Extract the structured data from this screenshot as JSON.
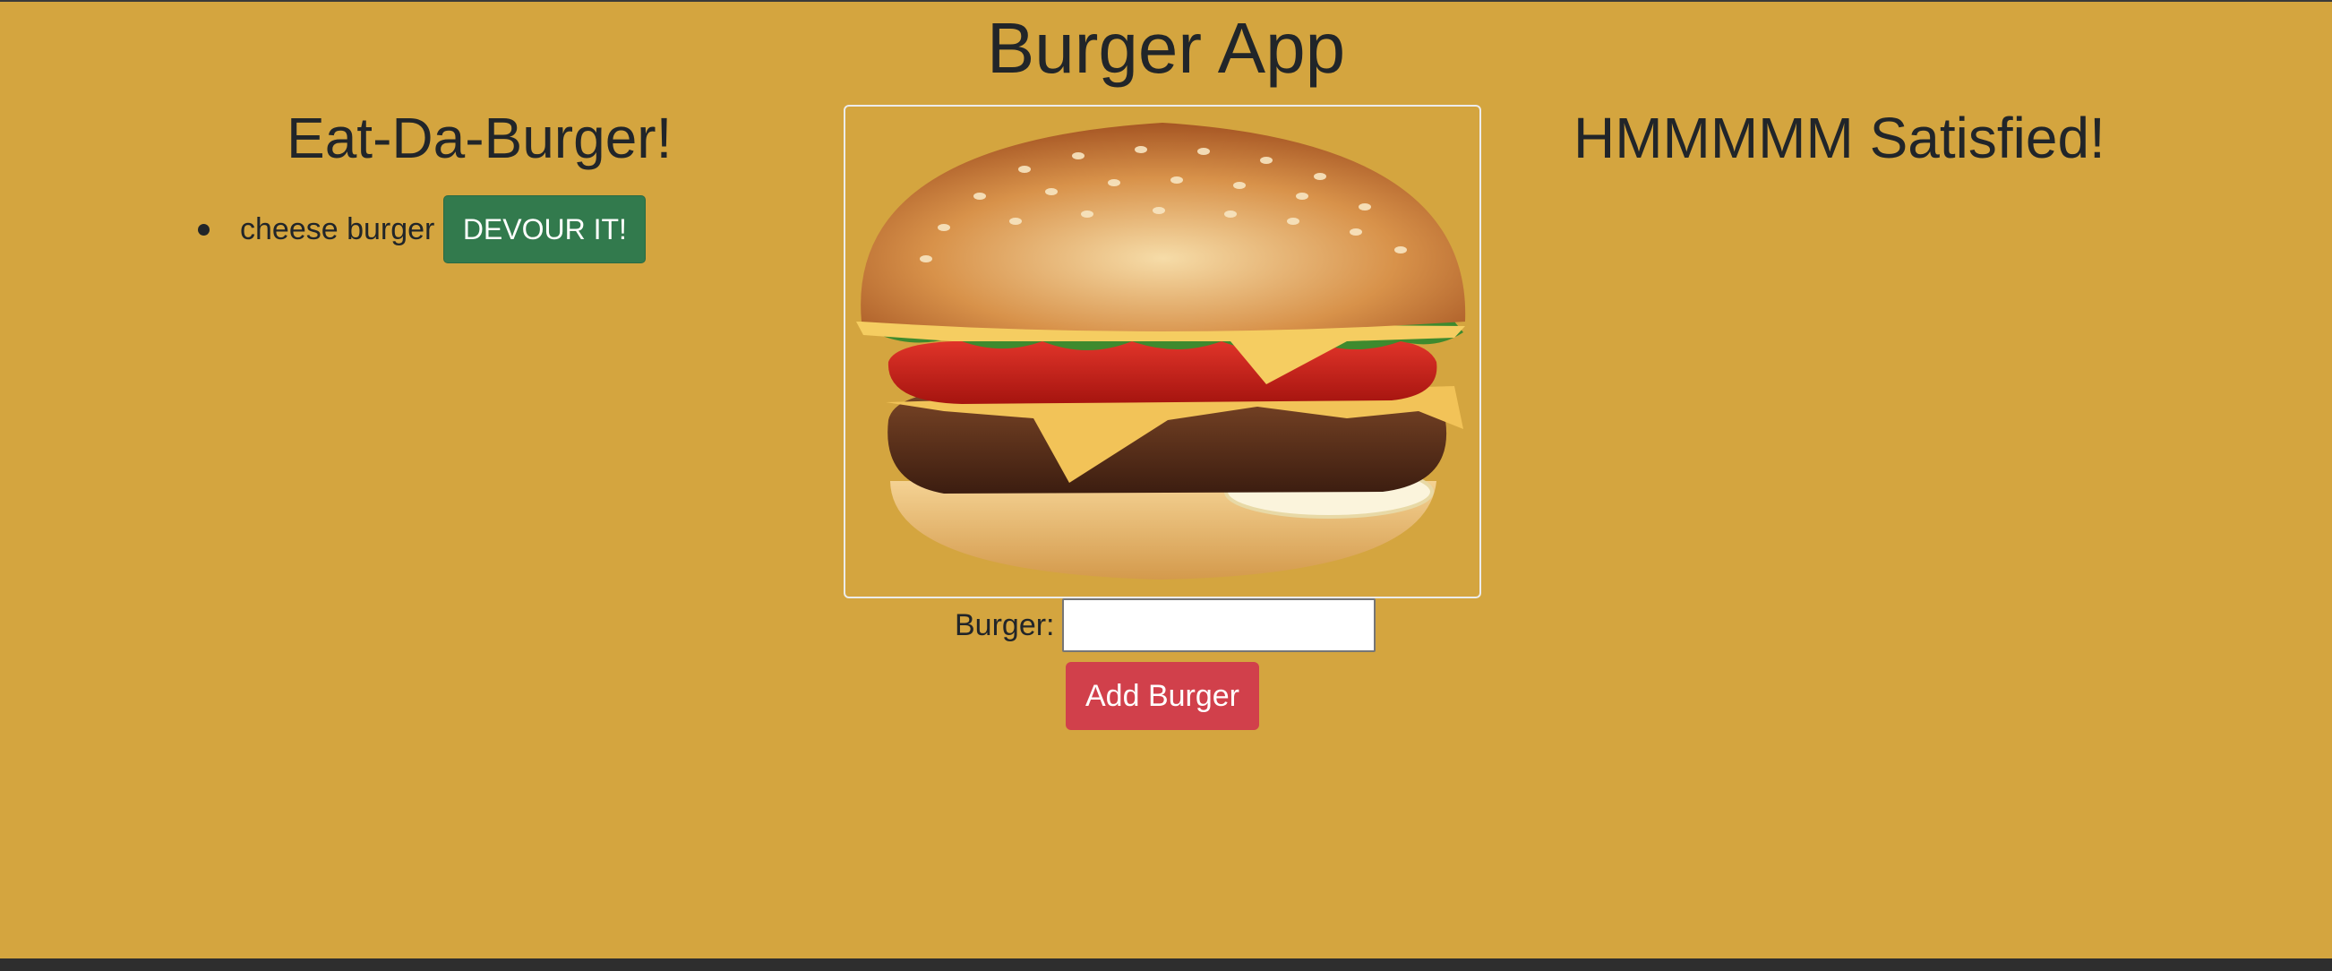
{
  "app": {
    "title": "Burger App"
  },
  "uneaten": {
    "heading": "Eat-Da-Burger!",
    "items": [
      {
        "name": "cheese burger",
        "button_label": "DEVOUR IT!"
      }
    ]
  },
  "eaten": {
    "heading": "HMMMMM Satisfied!",
    "items": []
  },
  "hero_image": {
    "icon": "burger-image"
  },
  "form": {
    "label": "Burger:",
    "input_value": "",
    "submit_label": "Add Burger"
  },
  "colors": {
    "background": "#d4a53f",
    "devour_button": "#327a4d",
    "add_button": "#d1404b",
    "text": "#212529"
  }
}
